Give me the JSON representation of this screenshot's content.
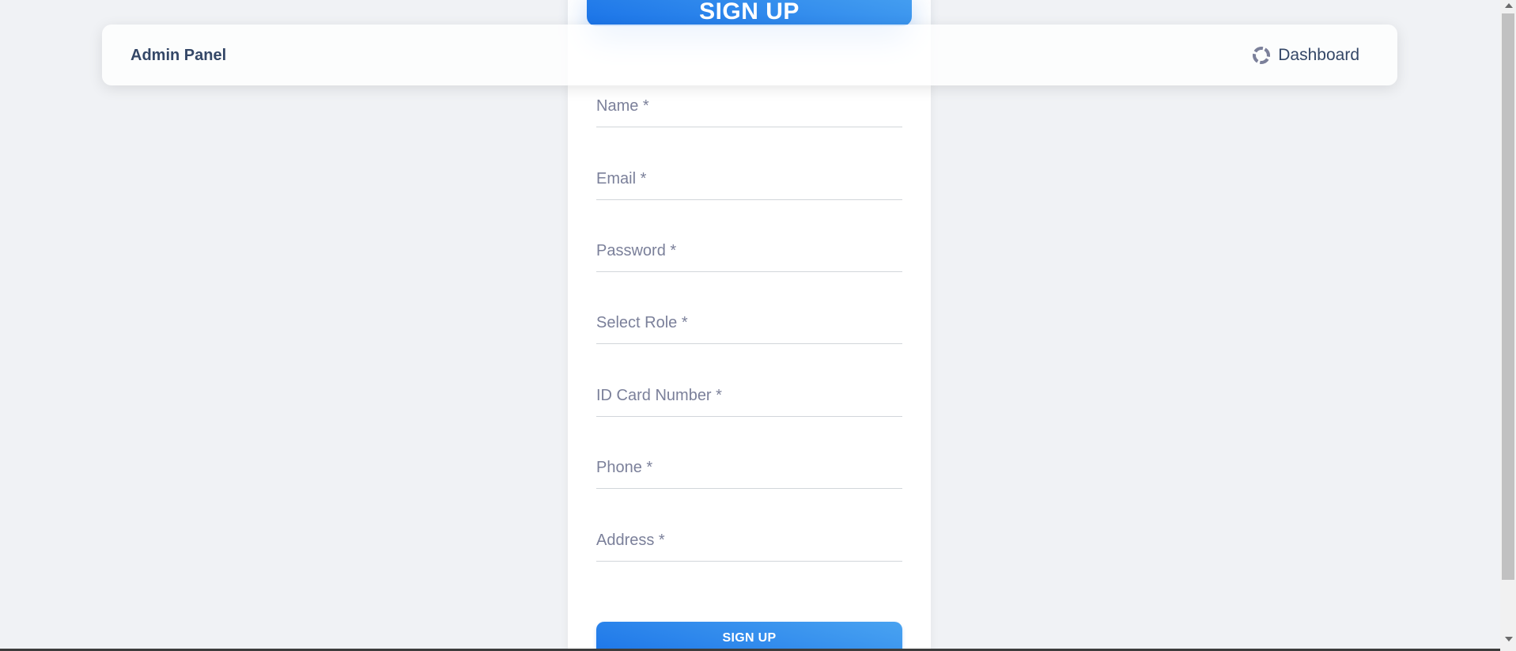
{
  "navbar": {
    "brand": "Admin Panel",
    "dashboard_link": "Dashboard",
    "dashboard_icon": "donut-chart-icon"
  },
  "signup_form": {
    "title": "SIGN UP",
    "fields": [
      {
        "label": "Name *"
      },
      {
        "label": "Email *"
      },
      {
        "label": "Password *"
      },
      {
        "label": "Select Role *"
      },
      {
        "label": "ID Card Number *"
      },
      {
        "label": "Phone *"
      },
      {
        "label": "Address *"
      }
    ],
    "submit_label": "SIGN UP"
  },
  "colors": {
    "background": "#f0f2f5",
    "accent": "#1A73E8",
    "accent_light": "#49a3f1",
    "text_dark": "#344767",
    "label_gray": "#7b809a"
  }
}
